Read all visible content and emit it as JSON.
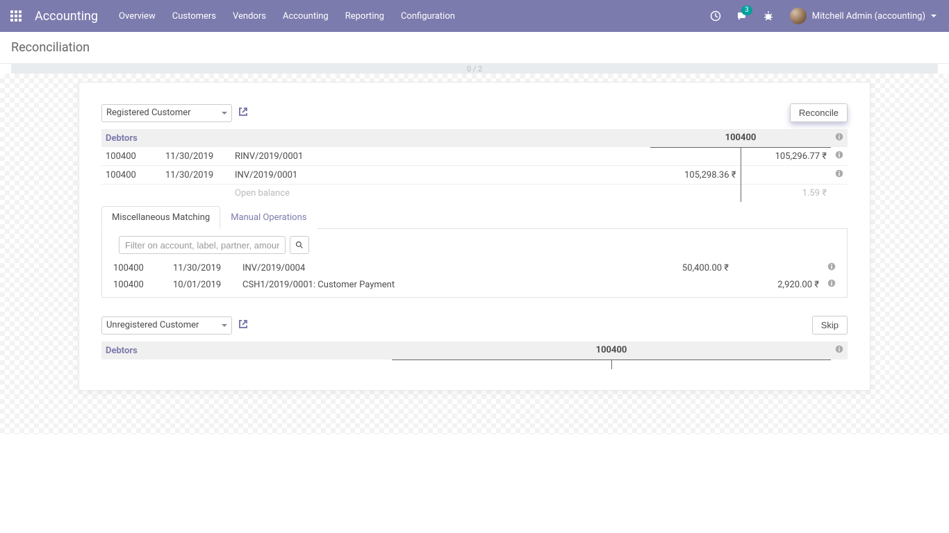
{
  "navbar": {
    "brand": "Accounting",
    "menu": [
      "Overview",
      "Customers",
      "Vendors",
      "Accounting",
      "Reporting",
      "Configuration"
    ],
    "messages_badge": "3",
    "user_name": "Mitchell Admin (accounting)"
  },
  "breadcrumb": {
    "title": "Reconciliation"
  },
  "progress": {
    "label": "0 / 2"
  },
  "blocks": [
    {
      "partner": "Registered Customer",
      "action_label": "Reconcile",
      "action_primary": true,
      "header": {
        "name": "Debtors",
        "code": "100400"
      },
      "rows": [
        {
          "code": "100400",
          "date": "11/30/2019",
          "label": "RINV/2019/0001",
          "debit": "",
          "credit": "105,296.77 ₹"
        },
        {
          "code": "100400",
          "date": "11/30/2019",
          "label": "INV/2019/0001",
          "debit": "105,298.36 ₹",
          "credit": ""
        }
      ],
      "open_balance": {
        "label": "Open balance",
        "credit": "1.59 ₹"
      },
      "tabs": {
        "active": "Miscellaneous Matching",
        "inactive": "Manual Operations"
      },
      "filter_placeholder": "Filter on account, label, partner, amount",
      "matches": [
        {
          "code": "100400",
          "date": "11/30/2019",
          "label": "INV/2019/0004",
          "debit": "50,400.00 ₹",
          "credit": ""
        },
        {
          "code": "100400",
          "date": "10/01/2019",
          "label": "CSH1/2019/0001: Customer Payment",
          "debit": "",
          "credit": "2,920.00 ₹"
        }
      ]
    },
    {
      "partner": "Unregistered Customer",
      "action_label": "Skip",
      "action_primary": false,
      "header": {
        "name": "Debtors",
        "code": "100400"
      }
    }
  ]
}
